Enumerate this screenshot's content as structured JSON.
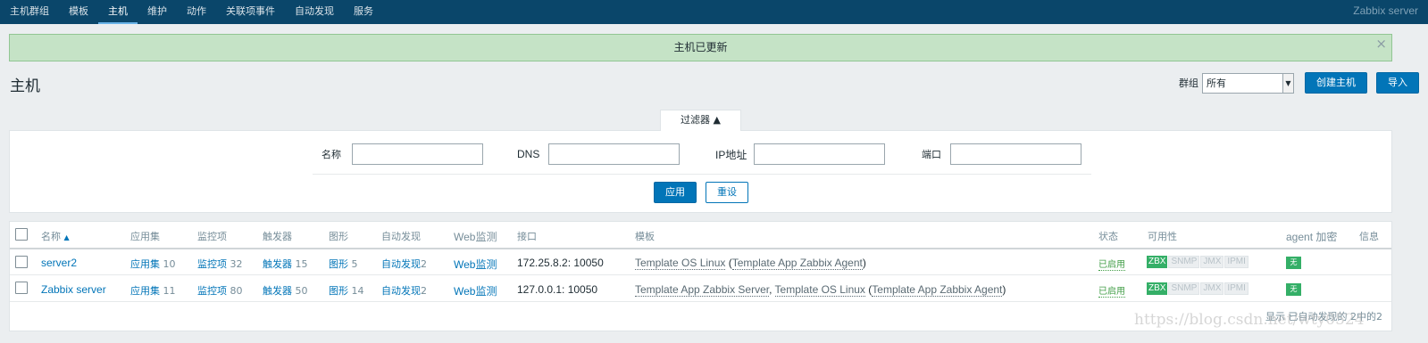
{
  "topbar": {
    "menu": [
      "主机群组",
      "模板",
      "主机",
      "维护",
      "动作",
      "关联项事件",
      "自动发现",
      "服务"
    ],
    "active_index": 2,
    "server_name": "Zabbix server"
  },
  "message": {
    "text": "主机已更新",
    "close": "×"
  },
  "page": {
    "title": "主机",
    "group_label": "群组",
    "group_value": "所有",
    "create_button": "创建主机",
    "import_button": "导入"
  },
  "filter": {
    "tab_label": "过滤器 ▲",
    "name_label": "名称",
    "dns_label": "DNS",
    "ip_label": "IP地址",
    "port_label": "端口",
    "apply_button": "应用",
    "reset_button": "重设"
  },
  "table": {
    "headers": {
      "name": "名称",
      "name_sort": "▲",
      "applications": "应用集",
      "items": "监控项",
      "triggers": "触发器",
      "graphs": "图形",
      "discovery": "自动发现",
      "web": "Web监测",
      "interface": "接口",
      "templates": "模板",
      "status": "状态",
      "availability": "可用性",
      "encryption": "agent 加密",
      "info": "信息"
    },
    "rows": [
      {
        "name": "server2",
        "app_label": "应用集",
        "app_count": "10",
        "items_label": "监控项",
        "items_count": "32",
        "trig_label": "触发器",
        "trig_count": "15",
        "graph_label": "图形",
        "graph_count": "5",
        "disc_label": "自动发现",
        "disc_count": "2",
        "web_label": "Web监测",
        "interface": "172.25.8.2: 10050",
        "tpl_main": "Template OS Linux",
        "tpl_open": " (",
        "tpl_inner": "Template App Zabbix Agent",
        "tpl_close": ")",
        "status": "已启用",
        "zbx": "ZBX",
        "snmp": "SNMP",
        "jmx": "JMX",
        "ipmi": "IPMI",
        "encryption": "无"
      },
      {
        "name": "Zabbix server",
        "app_label": "应用集",
        "app_count": "11",
        "items_label": "监控项",
        "items_count": "80",
        "trig_label": "触发器",
        "trig_count": "50",
        "graph_label": "图形",
        "graph_count": "14",
        "disc_label": "自动发现",
        "disc_count": "2",
        "web_label": "Web监测",
        "interface": "127.0.0.1: 10050",
        "tpl_main": "Template App Zabbix Server",
        "tpl_sep": ", ",
        "tpl_main2": "Template OS Linux",
        "tpl_open": " (",
        "tpl_inner": "Template App Zabbix Agent",
        "tpl_close": ")",
        "status": "已启用",
        "zbx": "ZBX",
        "snmp": "SNMP",
        "jmx": "JMX",
        "ipmi": "IPMI",
        "encryption": "无"
      }
    ],
    "footer": "显示 已自动发现的 2中的2"
  },
  "watermark": "https://blog.csdn.net/wty0524",
  "colors": {
    "topbar": "#0a466a",
    "accent": "#0275b8",
    "success_bg": "#c5e3c6",
    "enabled": "#429e47",
    "badge_green": "#34af67"
  }
}
